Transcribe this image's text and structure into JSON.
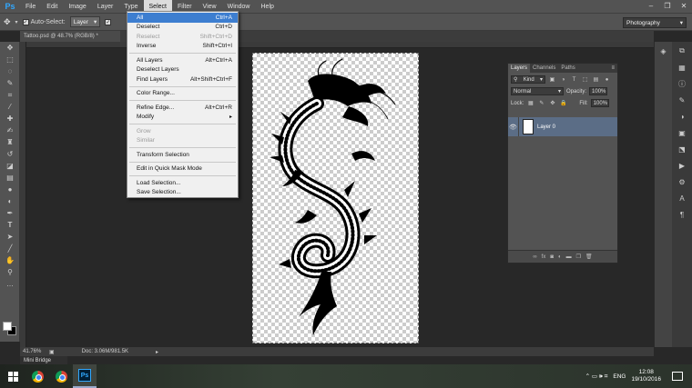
{
  "app": {
    "logo": "Ps"
  },
  "menubar": {
    "items": [
      "File",
      "Edit",
      "Image",
      "Layer",
      "Type",
      "Select",
      "Filter",
      "View",
      "Window",
      "Help"
    ],
    "active_index": 5
  },
  "window_controls": {
    "minimize": "–",
    "restore": "❐",
    "close": "✕"
  },
  "options": {
    "auto_select_label": "Auto-Select:",
    "auto_select_target": "Layer",
    "workspace": "Photography"
  },
  "document_tab": {
    "title": "Tattoo.psd @ 48.7% (RGB/8) *"
  },
  "select_menu": {
    "items": [
      {
        "label": "All",
        "shortcut": "Ctrl+A",
        "highlighted": true
      },
      {
        "label": "Deselect",
        "shortcut": "Ctrl+D"
      },
      {
        "label": "Reselect",
        "shortcut": "Shift+Ctrl+D",
        "disabled": true
      },
      {
        "label": "Inverse",
        "shortcut": "Shift+Ctrl+I"
      },
      {
        "separator": true
      },
      {
        "label": "All Layers",
        "shortcut": "Alt+Ctrl+A"
      },
      {
        "label": "Deselect Layers",
        "shortcut": ""
      },
      {
        "label": "Find Layers",
        "shortcut": "Alt+Shift+Ctrl+F"
      },
      {
        "separator": true
      },
      {
        "label": "Color Range...",
        "shortcut": ""
      },
      {
        "separator": true
      },
      {
        "label": "Refine Edge...",
        "shortcut": "Alt+Ctrl+R"
      },
      {
        "label": "Modify",
        "shortcut": "",
        "submenu": true
      },
      {
        "separator": true
      },
      {
        "label": "Grow",
        "shortcut": "",
        "disabled": true
      },
      {
        "label": "Similar",
        "shortcut": "",
        "disabled": true
      },
      {
        "separator": true
      },
      {
        "label": "Transform Selection",
        "shortcut": ""
      },
      {
        "separator": true
      },
      {
        "label": "Edit in Quick Mask Mode",
        "shortcut": ""
      },
      {
        "separator": true
      },
      {
        "label": "Load Selection...",
        "shortcut": ""
      },
      {
        "label": "Save Selection...",
        "shortcut": ""
      }
    ]
  },
  "layers_panel": {
    "tabs": [
      "Layers",
      "Channels",
      "Paths"
    ],
    "filter": "Kind",
    "blend_mode": "Normal",
    "opacity_label": "Opacity:",
    "opacity": "100%",
    "lock_label": "Lock:",
    "fill_label": "Fill:",
    "fill": "100%",
    "layer_name": "Layer 0",
    "footer_icons": [
      "link-icon",
      "fx-icon",
      "mask-icon",
      "adjustment-icon",
      "group-icon",
      "new-layer-icon",
      "trash-icon"
    ]
  },
  "status": {
    "zoom": "41.76%",
    "doc": "Doc: 3.06M/981.5K"
  },
  "mini_bridge": {
    "label": "Mini Bridge"
  },
  "taskbar": {
    "time": "12:08",
    "date": "19/10/2016",
    "lang": "ENG",
    "tray_icons": "⌃ ▭ 🕪 ⌗"
  },
  "colors": {
    "menu_highlight": "#3d7ed0",
    "layer_selected": "#5b6d86",
    "ps_blue": "#31a8ff"
  }
}
